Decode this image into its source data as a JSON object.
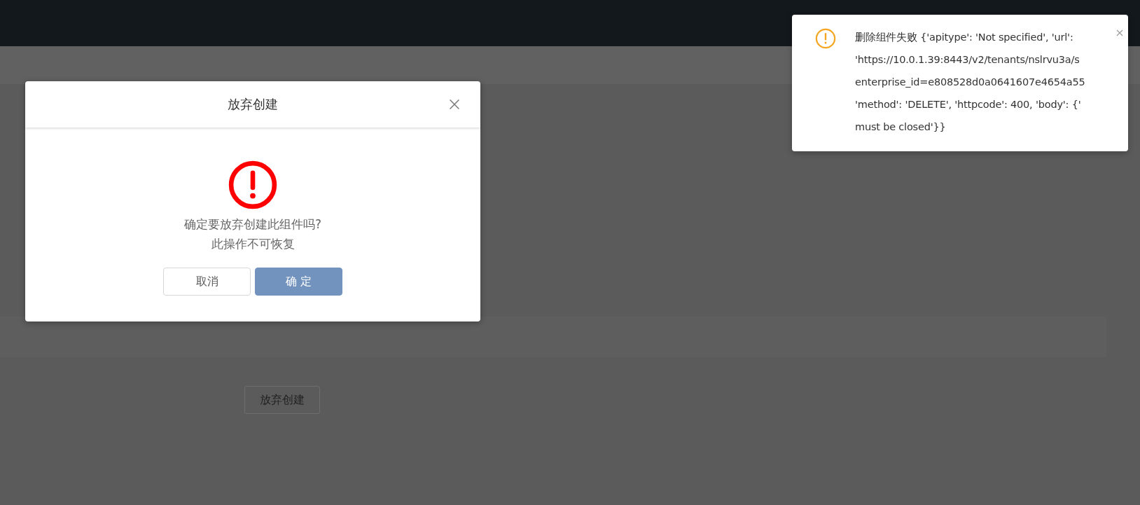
{
  "page": {
    "action_button": {
      "label": "放弃创建"
    }
  },
  "dialog": {
    "title": "放弃创建",
    "message_lines": [
      "确定要放弃创建此组件吗?",
      "此操作不可恢复"
    ],
    "buttons": [
      {
        "label": "取消",
        "kind": "secondary"
      },
      {
        "label": "确 定",
        "kind": "primary"
      }
    ]
  },
  "notification": {
    "kind": "warning",
    "lines": [
      "删除组件失败 {'apitype': 'Not specified', 'url':",
      "'https://10.0.1.39:8443/v2/tenants/nslrvu3a/s",
      "enterprise_id=e808528d0a0641607e4654a55",
      "'method': 'DELETE', 'httpcode': 400, 'body': {'",
      "must be closed'}}"
    ]
  }
}
